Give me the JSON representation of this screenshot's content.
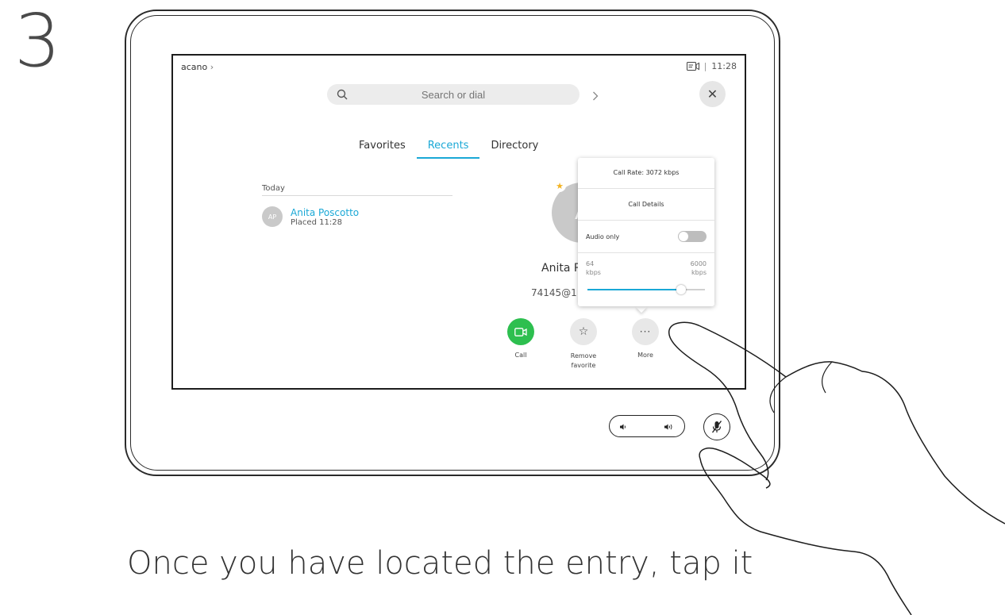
{
  "step": "3",
  "device": {
    "brand": "acano",
    "time": "11:28",
    "search": {
      "placeholder": "Search or dial"
    },
    "tabs": [
      {
        "label": "Favorites"
      },
      {
        "label": "Recents"
      },
      {
        "label": "Directory"
      }
    ],
    "active_tab": "Recents",
    "recents": {
      "heading": "Today",
      "items": [
        {
          "initials": "AP",
          "name": "Anita Poscotto",
          "sub": "Placed 11:28"
        }
      ]
    },
    "contact": {
      "initials": "A",
      "name": "Anita P",
      "address": "74145@1"
    },
    "popup": {
      "call_rate": "Call Rate: 3072 kbps",
      "call_details": "Call Details",
      "audio_only_label": "Audio only",
      "audio_only_on": false,
      "range_min": "64",
      "range_max": "6000",
      "unit": "kbps",
      "slider_fraction": 0.8
    },
    "actions": {
      "call": "Call",
      "remove_favorite": "Remove favorite",
      "more": "More"
    }
  },
  "instruction": "Once you have located the entry, tap it",
  "colors": {
    "accent": "#1aa8d6",
    "call_green": "#2dbf4f",
    "favorite_star": "#f3b322"
  }
}
